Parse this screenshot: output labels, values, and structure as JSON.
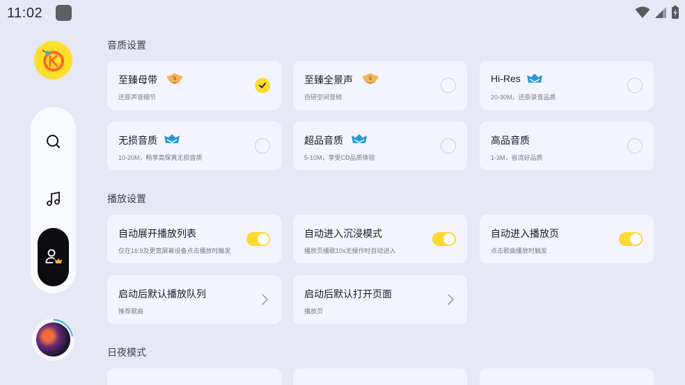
{
  "status_bar": {
    "time": "11:02"
  },
  "sections": {
    "quality": {
      "title": "音质设置"
    },
    "playback": {
      "title": "播放设置"
    },
    "daynight": {
      "title": "日夜模式"
    }
  },
  "quality_options": [
    {
      "title": "至臻母带",
      "sub": "还原声音细节",
      "badge": "svip",
      "selected": true
    },
    {
      "title": "至臻全景声",
      "sub": "自研空间音频",
      "badge": "svip",
      "selected": false
    },
    {
      "title": "Hi-Res",
      "sub": "20-30M，还原录音品质",
      "badge": "vip",
      "selected": false
    },
    {
      "title": "无损音质",
      "sub": "10-20M，畅享高保真无损音质",
      "badge": "vip",
      "selected": false
    },
    {
      "title": "超品音质",
      "sub": "5-10M，享受CD品质体验",
      "badge": "vip",
      "selected": false
    },
    {
      "title": "高品音质",
      "sub": "1-3M，省流好品质",
      "badge": "",
      "selected": false
    }
  ],
  "playback_options": [
    {
      "title": "自动展开播放列表",
      "sub": "仅在16:9及更宽屏幕设备点击播放时触发",
      "control": "toggle",
      "on": true
    },
    {
      "title": "自动进入沉浸模式",
      "sub": "播放页播歌10s无操作时自动进入",
      "control": "toggle",
      "on": true
    },
    {
      "title": "自动进入播放页",
      "sub": "点击歌曲播放时触发",
      "control": "toggle",
      "on": true
    },
    {
      "title": "启动后默认播放队列",
      "sub": "推荐歌曲",
      "control": "chevron"
    },
    {
      "title": "启动后默认打开页面",
      "sub": "播放页",
      "control": "chevron"
    }
  ],
  "nav": {
    "items": [
      {
        "icon": "search-icon"
      },
      {
        "icon": "music-note-icon"
      },
      {
        "icon": "profile-icon"
      }
    ]
  },
  "colors": {
    "accent": "#ffd92e",
    "background": "#e6e8f6",
    "card": "#f3f4fd"
  }
}
